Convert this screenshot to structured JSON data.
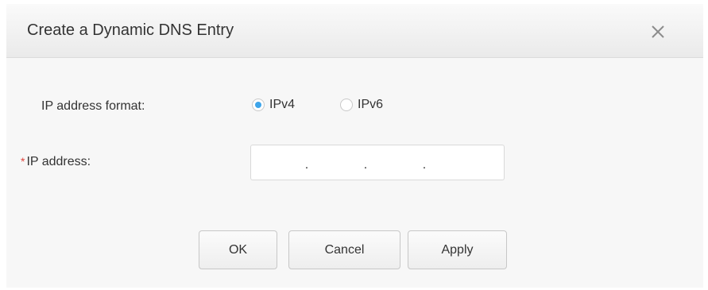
{
  "dialog": {
    "title": "Create a Dynamic DNS Entry",
    "close_icon": "close-icon"
  },
  "form": {
    "ip_format": {
      "label": "IP address format:",
      "options": [
        {
          "label": "IPv4",
          "selected": true
        },
        {
          "label": "IPv6",
          "selected": false
        }
      ]
    },
    "ip_address": {
      "required_marker": "*",
      "label": "IP address:",
      "octets": [
        "",
        "",
        "",
        ""
      ],
      "separator": "."
    }
  },
  "buttons": {
    "ok": "OK",
    "cancel": "Cancel",
    "apply": "Apply"
  },
  "colors": {
    "accent": "#3ea5ea",
    "required": "#e0443c"
  }
}
